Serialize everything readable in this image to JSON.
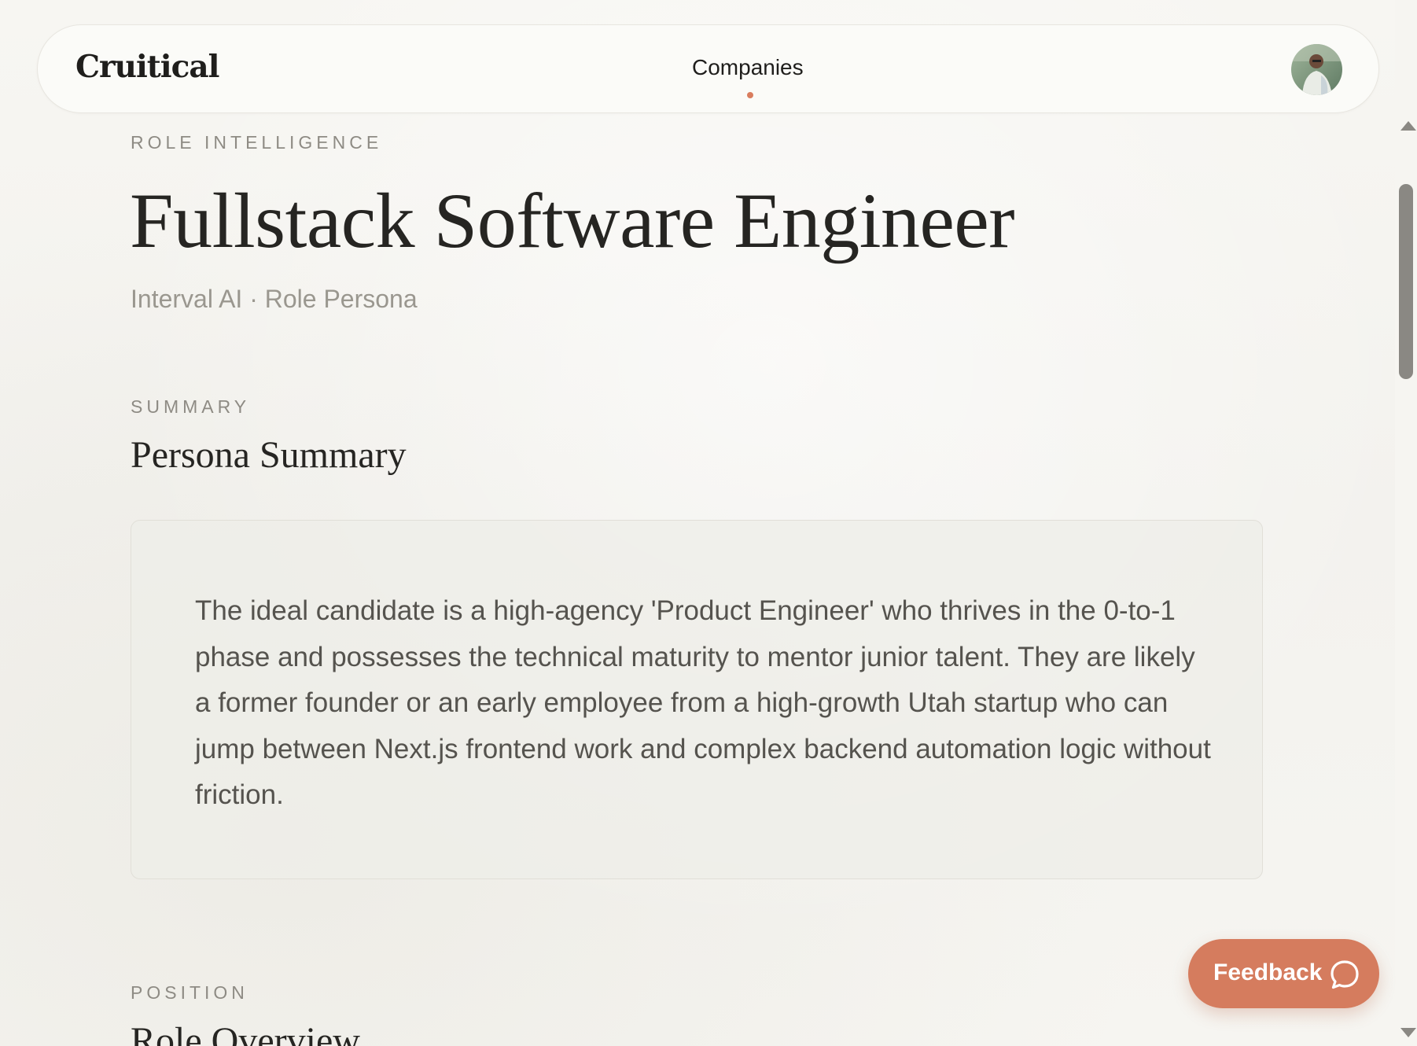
{
  "header": {
    "logo": "Cruitical",
    "nav": {
      "companies_label": "Companies"
    },
    "avatar_icon": "user-avatar"
  },
  "page": {
    "eyebrow": "ROLE INTELLIGENCE",
    "title": "Fullstack Software Engineer",
    "subtitle": "Interval AI · Role Persona"
  },
  "summary": {
    "eyebrow": "SUMMARY",
    "heading": "Persona Summary",
    "text": "The ideal candidate is a high-agency 'Product Engineer' who thrives in the 0-to-1 phase and possesses the technical maturity to mentor junior talent. They are likely a former founder or an early employee from a high-growth Utah startup who can jump between Next.js frontend work and complex backend automation logic without friction."
  },
  "position": {
    "eyebrow": "POSITION",
    "heading": "Role Overview"
  },
  "feedback": {
    "label": "Feedback",
    "icon": "chat-bubble-icon"
  },
  "colors": {
    "accent": "#d57c5e",
    "background": "#f6f5f1",
    "text_primary": "#262522",
    "text_muted": "#8e8b84"
  }
}
